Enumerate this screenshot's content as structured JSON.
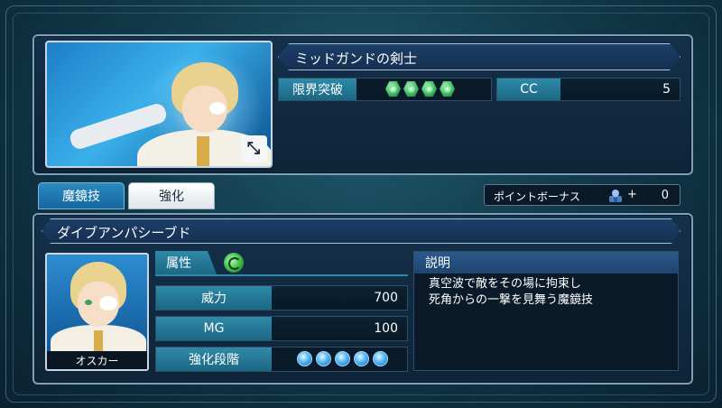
{
  "header": {
    "title": "ミッドガンドの剣士",
    "limit_break_label": "限界突破",
    "limit_break_count": 4,
    "cc_label": "CC",
    "cc_value": "5"
  },
  "portrait": {
    "expand_icon": "expand-arrows-icon"
  },
  "tabs": [
    {
      "label": "魔鏡技",
      "active": true
    },
    {
      "label": "強化",
      "active": false
    }
  ],
  "bonus": {
    "label": "ポイントボーナス",
    "plus": "+",
    "value": "0"
  },
  "skill": {
    "name": "ダイブアンパシーブド",
    "attribute_label": "属性",
    "attribute_icon": "wind-element-icon",
    "stats": [
      {
        "label": "威力",
        "value": "700"
      },
      {
        "label": "MG",
        "value": "100"
      }
    ],
    "enhance_label": "強化段階",
    "enhance_level": 5,
    "description_title": "説明",
    "description_lines": [
      "真空波で敵をその場に拘束し",
      "死角からの一撃を見舞う魔鏡技"
    ]
  },
  "character": {
    "name": "オスカー"
  },
  "colors": {
    "accent": "#2e8aa8",
    "panel": "#14304a",
    "gem_green": "#49c46a",
    "orb_blue": "#55b9f5"
  }
}
